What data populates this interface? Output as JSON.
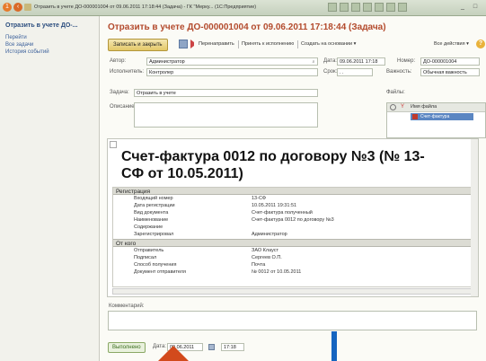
{
  "titlebar": {
    "text": "Отразить в учете ДО-000001004 от 09.06.2011 17:18:44 (Задача) - ГК \"Мерку... (1С:Предприятие)",
    "minimize": "_",
    "maximize": "□"
  },
  "sidebar": {
    "title": "Отразить в учете ДО-...",
    "items": [
      {
        "label": "Перейти"
      },
      {
        "label": "Все задачи"
      },
      {
        "label": "История событий"
      }
    ]
  },
  "header": {
    "title": "Отразить в учете ДО-000001004 от 09.06.2011 17:18:44 (Задача)"
  },
  "toolbar": {
    "save_close": "Записать и закрыть",
    "redirect": "Перенаправить",
    "accept": "Принять к исполнению",
    "create_based": "Создать на основании ▾",
    "all_actions": "Все действия ▾",
    "help": "?"
  },
  "form": {
    "author_label": "Автор:",
    "author_value": "Администратор",
    "date_label": "Дата:",
    "date_value": "09.06.2011 17:18",
    "number_label": "Номер:",
    "number_value": "ДО-000001004",
    "executor_label": "Исполнитель:",
    "executor_value": "Контролер",
    "deadline_label": "Срок:",
    "deadline_value": " .  .  ",
    "importance_label": "Важность:",
    "importance_value": "Обычная важность",
    "task_label": "Задача:",
    "task_value": "Отразить в учете",
    "files_label": "Файлы:",
    "description_label": "Описание:"
  },
  "files": {
    "col_name": "Имя файла",
    "items": [
      "Счет-фактура"
    ]
  },
  "document": {
    "title": "Счет-фактура 0012 по договору №3 (№ 13-СФ от 10.05.2011)",
    "section1": "Регистрация",
    "rows1": [
      {
        "k": "Входящий номер",
        "v": "13-СФ"
      },
      {
        "k": "Дата регистрации",
        "v": "10.05.2011 19:31:51"
      },
      {
        "k": "Вид документа",
        "v": "Счет-фактура полученный"
      },
      {
        "k": "Наименование",
        "v": "Счет-фактура 0012 по договору №3"
      },
      {
        "k": "Содержание",
        "v": ""
      },
      {
        "k": "Зарегистрировал",
        "v": "Администратор"
      }
    ],
    "section2": "От кого",
    "rows2": [
      {
        "k": "Отправитель",
        "v": "ЗАО Клауст"
      },
      {
        "k": "Подписал",
        "v": "Сергеев О.П."
      },
      {
        "k": "Способ получения",
        "v": "Почта"
      },
      {
        "k": "Документ отправителя",
        "v": "№ 0012 от 10.05.2011"
      }
    ]
  },
  "comment": {
    "label": "Комментарий:"
  },
  "status": {
    "done": "Выполнено",
    "date_label": "Дата:",
    "date_value": "09.06.2011",
    "time_value": "17:18"
  },
  "colors": {
    "title_accent": "#b34a2c",
    "link": "#3a5f9a",
    "overlay_red": "#d24a1c",
    "overlay_blue": "#1565c0"
  }
}
